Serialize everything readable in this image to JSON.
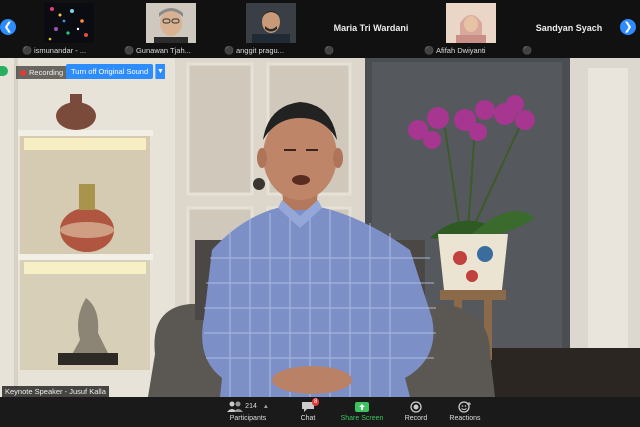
{
  "gallery": {
    "tiles": [
      {
        "name": "ismunandar - ...",
        "has_video": true
      },
      {
        "name": "Gunawan Tjah...",
        "has_video": true
      },
      {
        "name": "anggit pragu...",
        "has_video": true
      },
      {
        "name": "Maria Tri Wardani",
        "has_video": false
      },
      {
        "name": "Afifah Dwiyanti",
        "has_video": true
      },
      {
        "name": "Sandyan Syach",
        "has_video": false
      }
    ]
  },
  "meeting": {
    "recording_label": "Recording",
    "original_sound_button": "Turn off Original Sound",
    "speaker_label": "Keynote Speaker - Jusuf Kalla"
  },
  "toolbar": {
    "participants": {
      "label": "Participants",
      "count": "214"
    },
    "chat": {
      "label": "Chat",
      "badge": "8"
    },
    "share": {
      "label": "Share Screen"
    },
    "record": {
      "label": "Record"
    },
    "reactions": {
      "label": "Reactions"
    }
  },
  "colors": {
    "accent": "#2d8cff",
    "share_green": "#3bc35f",
    "muted_red": "#e53935"
  }
}
